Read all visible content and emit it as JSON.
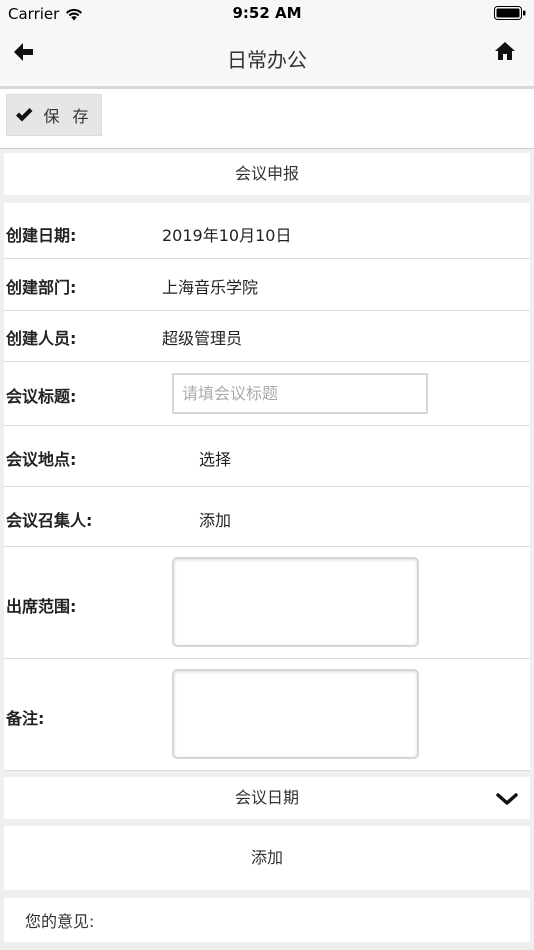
{
  "status_bar": {
    "carrier": "Carrier",
    "time": "9:52 AM"
  },
  "nav": {
    "title": "日常办公",
    "back_icon": "arrow-left-icon",
    "home_icon": "home-icon"
  },
  "toolbar": {
    "save_label": "保 存",
    "save_icon": "checkmark-icon"
  },
  "form": {
    "section_title": "会议申报",
    "fields": {
      "create_date": {
        "label": "创建日期:",
        "value": "2019年10月10日"
      },
      "create_dept": {
        "label": "创建部门:",
        "value": "上海音乐学院"
      },
      "creator": {
        "label": "创建人员:",
        "value": "超级管理员"
      },
      "meeting_title": {
        "label": "会议标题:",
        "placeholder": "请填会议标题",
        "value": ""
      },
      "meeting_location": {
        "label": "会议地点:",
        "action": "选择"
      },
      "meeting_convener": {
        "label": "会议召集人:",
        "action": "添加"
      },
      "attendance_scope": {
        "label": "出席范围:"
      },
      "remarks": {
        "label": "备注:"
      }
    }
  },
  "meeting_date": {
    "title": "会议日期",
    "chevron_icon": "chevron-down-icon",
    "add_label": "添加"
  },
  "opinion": {
    "label": "您的意见:"
  },
  "colors": {
    "background": "#efefef",
    "card": "#ffffff",
    "button_bg": "#e6e6e6",
    "border": "#d6d6d6"
  }
}
